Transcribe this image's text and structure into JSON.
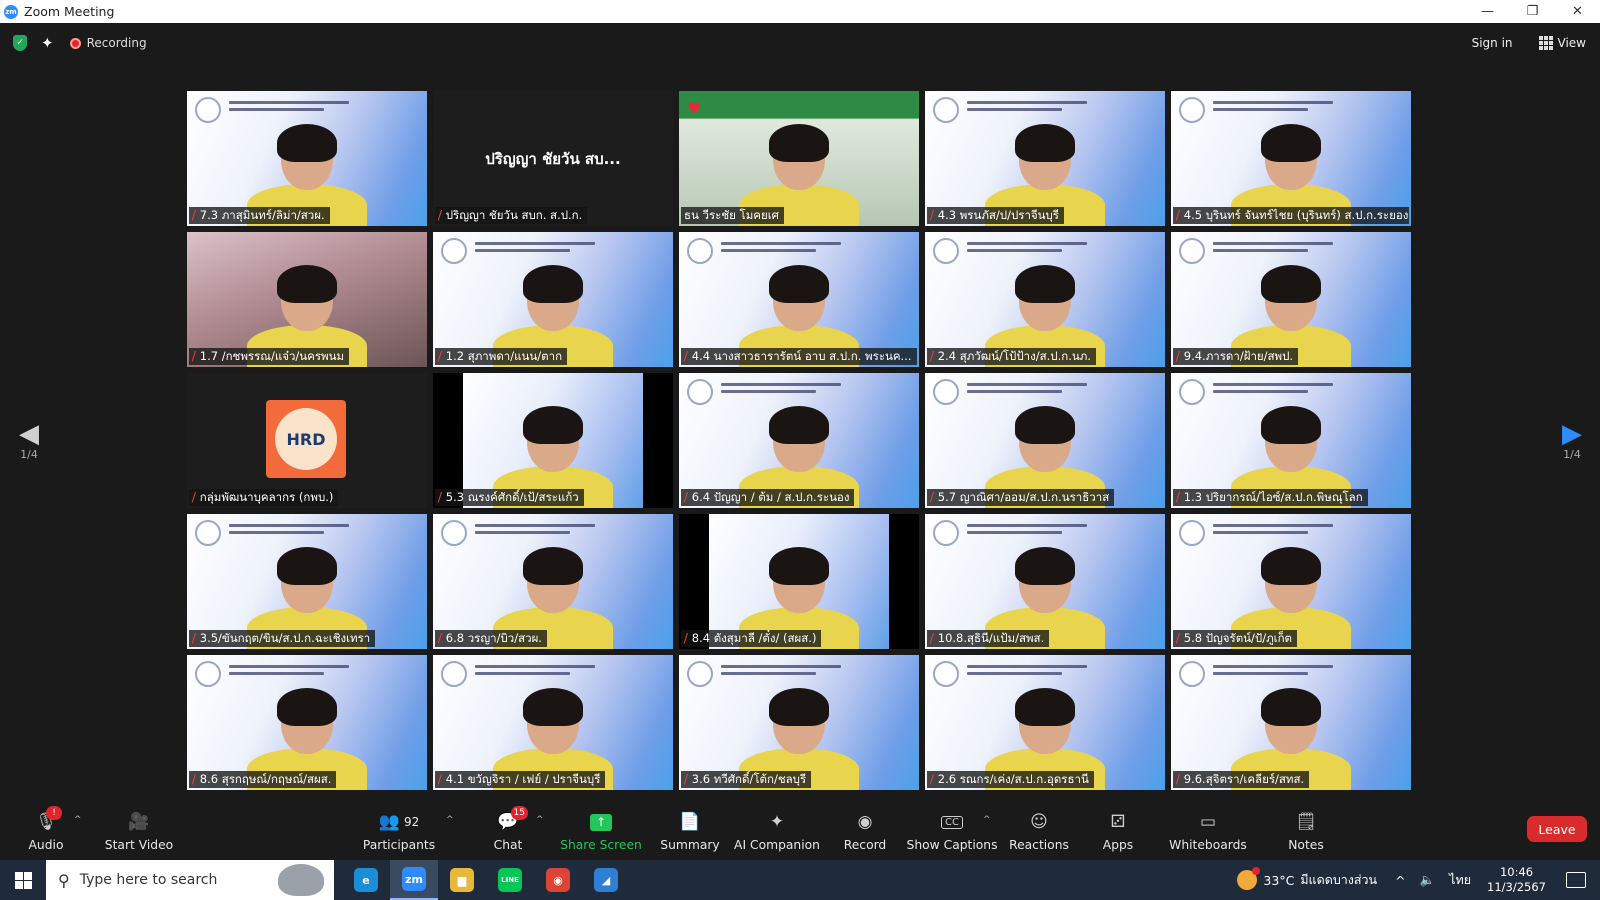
{
  "window": {
    "title": "Zoom Meeting",
    "app_logo": "zm",
    "controls": [
      "—",
      "❐",
      "✕"
    ]
  },
  "topbar": {
    "recording_label": "Recording",
    "sign_in": "Sign in",
    "view": "View"
  },
  "tiles": [
    {
      "name": "7.3 ภาสุมินทร์/ลิม่า/สวผ.",
      "kind": "banner"
    },
    {
      "name": "ปริญญา ชัยวัน สบก. ส.ป.ก.",
      "kind": "dark",
      "center": "ปริญญา ชัยวัน สบ..."
    },
    {
      "name": "ธน วีระชัย โมคยเศ",
      "kind": "office",
      "muted": false
    },
    {
      "name": "4.3 พรนภัส/ป/ปราจีนบุรี",
      "kind": "banner"
    },
    {
      "name": "4.5 บุรินทร์ จันทร์ไชย (บุรินทร์) ส.ป.ก.ระยอง",
      "kind": "banner"
    },
    {
      "name": "1.7 /กชพรรณ/แจ๋ว/นครพนม",
      "kind": "room"
    },
    {
      "name": "1.2 สุภาพดา/แนน/ตาก",
      "kind": "banner"
    },
    {
      "name": "4.4 นางสาวธารารัตน์ อาบ ส.ป.ก. พระนค...",
      "kind": "banner"
    },
    {
      "name": "2.4 สุภวัฒน์/โป้ป้าง/ส.ป.ก.นภ.",
      "kind": "banner"
    },
    {
      "name": "9.4.ภารดา/ฝ้าย/สพป.",
      "kind": "banner"
    },
    {
      "name": "กลุ่มพัฒนาบุคลากร (กพบ.)",
      "kind": "logo",
      "logo": "HRD"
    },
    {
      "name": "5.3 ณรงค์ศักดิ์/เป้/สระแก้ว",
      "kind": "narrow"
    },
    {
      "name": "6.4 ปัญญา / ต้ม / ส.ป.ก.ระนอง",
      "kind": "banner"
    },
    {
      "name": "5.7 ญาณิศา/ออม/ส.ป.ก.นราธิวาส",
      "kind": "banner"
    },
    {
      "name": "1.3 ปริยากรณ์/ไอซ์/ส.ป.ก.พิษณุโลก",
      "kind": "banner"
    },
    {
      "name": "3.5/ขันกฤต/ขิน/ส.ป.ก.ฉะเชิงเทรา",
      "kind": "banner"
    },
    {
      "name": "6.8 วรญา/บิว/สวผ.",
      "kind": "banner"
    },
    {
      "name": "8.4 ตังสุมาลี /ตั๋ง/ (สผส.)",
      "kind": "narrow"
    },
    {
      "name": "10.8.สุธินี/แป้ม/สพส.",
      "kind": "banner"
    },
    {
      "name": "5.8 ปัญจรัตน์/ปั/ภูเก็ต",
      "kind": "banner"
    },
    {
      "name": "8.6 สุรกฤษณ์/กฤษณ์/สผส.",
      "kind": "banner"
    },
    {
      "name": "4.1 ขวัญจิรา / เฟย์ / ปราจีนบุรี",
      "kind": "banner"
    },
    {
      "name": "3.6 ทวีศักดิ์/โต้ก/ชลบุรี",
      "kind": "banner"
    },
    {
      "name": "2.6 รณกร/เค่ง/ส.ป.ก.อุดรธานี",
      "kind": "banner"
    },
    {
      "name": "9.6.สุจิตรา/เคลียร์/สทส.",
      "kind": "banner"
    }
  ],
  "pager": {
    "left": "1/4",
    "right": "1/4"
  },
  "toolbar": {
    "audio": "Audio",
    "start_video": "Start Video",
    "participants": "Participants",
    "participants_count": "92",
    "chat": "Chat",
    "chat_badge": "15",
    "share_screen": "Share Screen",
    "summary": "Summary",
    "ai_companion": "AI Companion",
    "record": "Record",
    "show_captions": "Show Captions",
    "captions_icon": "CC",
    "reactions": "Reactions",
    "apps": "Apps",
    "whiteboards": "Whiteboards",
    "notes": "Notes",
    "leave": "Leave",
    "audio_badge": "!"
  },
  "taskbar": {
    "search_placeholder": "Type here to search",
    "apps": [
      {
        "id": "edge",
        "label": "e",
        "color": "#1a8fd8"
      },
      {
        "id": "zoom",
        "label": "zm",
        "color": "#2d8cff",
        "active": true
      },
      {
        "id": "explorer",
        "label": "▆",
        "color": "#e8b83c"
      },
      {
        "id": "line",
        "label": "LINE",
        "color": "#06c755"
      },
      {
        "id": "chrome",
        "label": "◉",
        "color": "#db4437"
      },
      {
        "id": "photos",
        "label": "◢",
        "color": "#2f7fd6"
      }
    ],
    "weather": "33°C",
    "weather_desc": "มีแดดบางส่วน",
    "lang": "ไทย",
    "time": "10:46",
    "date": "11/3/2567"
  },
  "colors": {
    "accent": "#2d8cff",
    "share_green": "#23c65a",
    "leave_red": "#d92b2b",
    "active_speaker": "#b8e45a"
  }
}
